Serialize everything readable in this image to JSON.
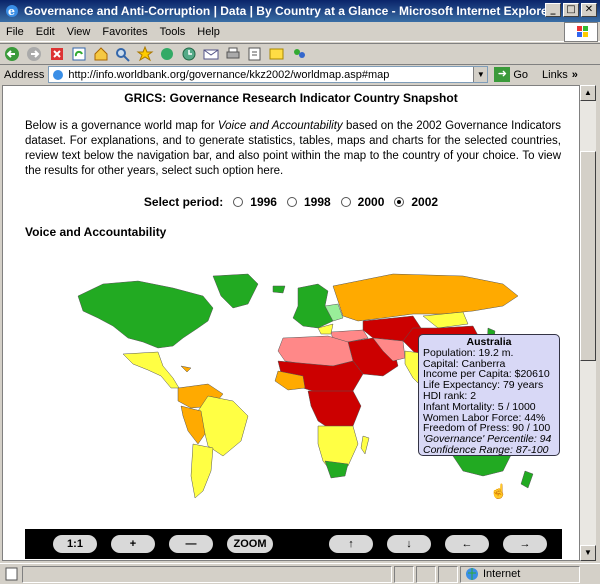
{
  "window": {
    "title": "Governance and Anti-Corruption | Data | By Country at a Glance - Microsoft Internet Explorer"
  },
  "menu": [
    "File",
    "Edit",
    "View",
    "Favorites",
    "Tools",
    "Help"
  ],
  "address": {
    "label": "Address",
    "url": "http://info.worldbank.org/governance/kkz2002/worldmap.asp#map",
    "go": "Go",
    "links": "Links"
  },
  "page": {
    "heading": "GRICS: Governance Research Indicator Country Snapshot",
    "intro_pre": "Below is a governance world map for ",
    "intro_em": "Voice and Accountability",
    "intro_post": " based on the 2002 Governance Indicators dataset. For explanations, and to generate statistics, tables, maps and charts for the selected countries, review text below the navigation bar, and also point within the map to the country of your choice. To view the results for other years, select such option here.",
    "period_label": "Select period:",
    "periods": [
      "1996",
      "1998",
      "2000",
      "2002"
    ],
    "selected_period": "2002",
    "section_title": "Voice and Accountability"
  },
  "popup": {
    "country": "Australia",
    "lines": [
      "Population: 19.2 m.",
      "Capital: Canberra",
      "Income per Capita: $20610",
      "Life Expectancy: 79 years",
      "HDI rank: 2",
      "Infant Mortality: 5 / 1000",
      "Women Labor Force: 44%",
      "Freedom of Press: 90 / 100"
    ],
    "italic_lines": [
      "'Governance' Percentile: 94",
      "Confidence Range: 87-100"
    ]
  },
  "nav": {
    "buttons": [
      "1:1",
      "+",
      "—",
      "ZOOM",
      "↑",
      "↓",
      "←",
      "→"
    ]
  },
  "status": {
    "zone": "Internet"
  },
  "colors": {
    "dark_green": "#22aa22",
    "light_green": "#99ee99",
    "yellow": "#ffff44",
    "orange": "#ffaa00",
    "pink": "#ff8888",
    "red": "#cc0000"
  }
}
